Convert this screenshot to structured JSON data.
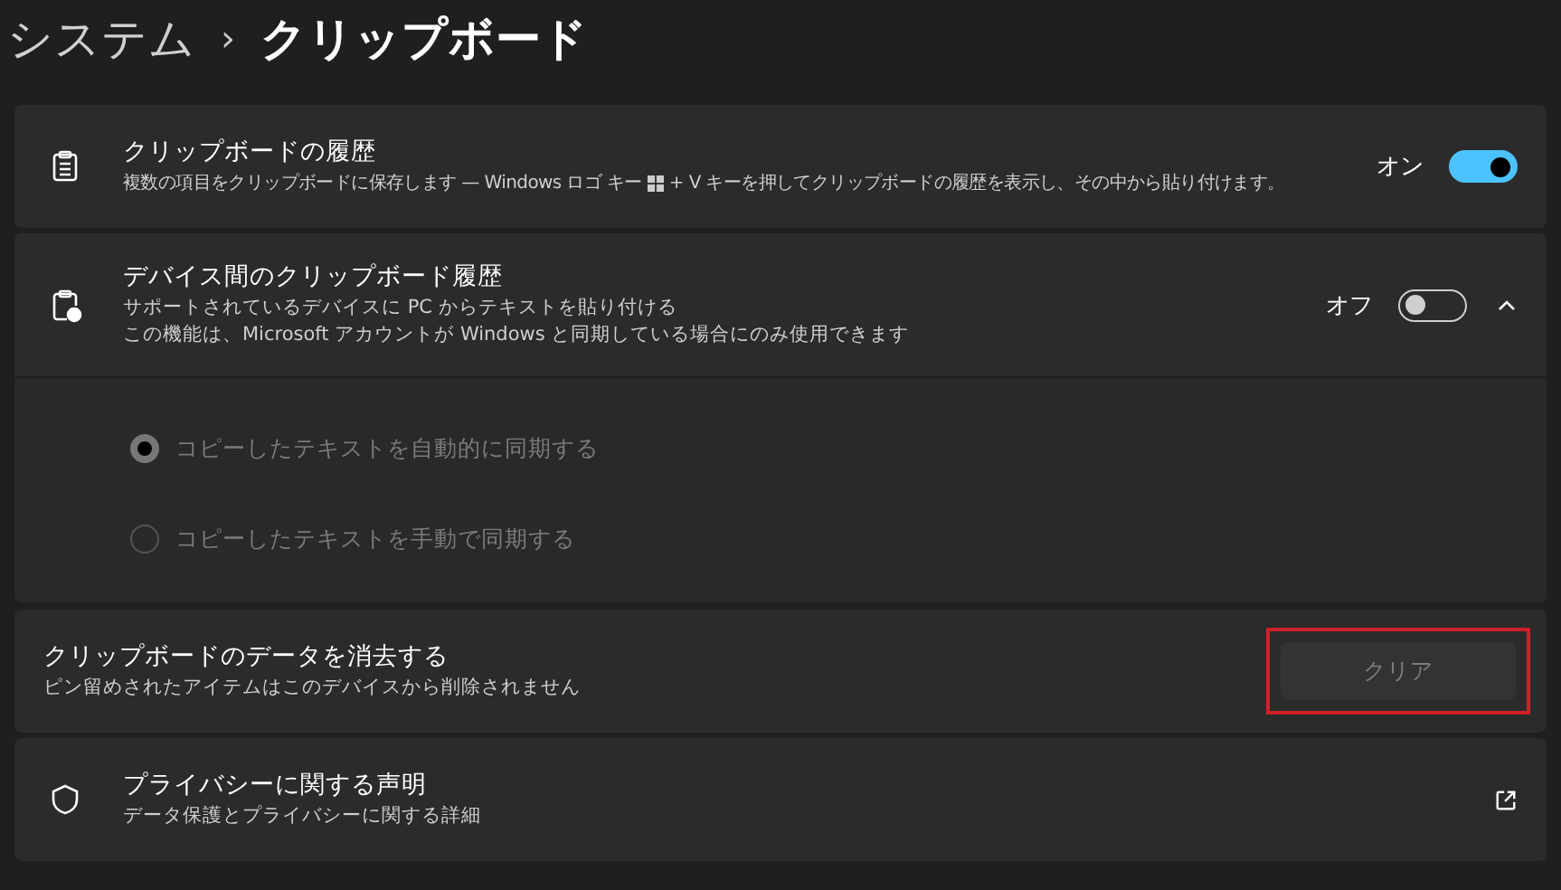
{
  "breadcrumb": {
    "parent": "システム",
    "separator": "›",
    "current": "クリップボード"
  },
  "history": {
    "title": "クリップボードの履歴",
    "description_before": "複数の項目をクリップボードに保存します — Windows ロゴ キー",
    "description_after": "+ V キーを押してクリップボードの履歴を表示し、その中から貼り付けます。",
    "toggle_label": "オン",
    "on": true
  },
  "sync": {
    "title": "デバイス間のクリップボード履歴",
    "lines": [
      "サポートされているデバイスに PC からテキストを貼り付ける",
      "この機能は、Microsoft アカウントが Windows と同期している場合にのみ使用できます"
    ],
    "toggle_label": "オフ",
    "on": false,
    "expanded": true,
    "options": [
      {
        "label": "コピーしたテキストを自動的に同期する",
        "selected": true,
        "disabled": true
      },
      {
        "label": "コピーしたテキストを手動で同期する",
        "selected": false,
        "disabled": true
      }
    ]
  },
  "clear": {
    "title": "クリップボードのデータを消去する",
    "description": "ピン留めされたアイテムはこのデバイスから削除されません",
    "button": "クリア",
    "button_disabled": true,
    "highlighted": true
  },
  "privacy": {
    "title": "プライバシーに関する声明",
    "description": "データ保護とプライバシーに関する詳細"
  }
}
